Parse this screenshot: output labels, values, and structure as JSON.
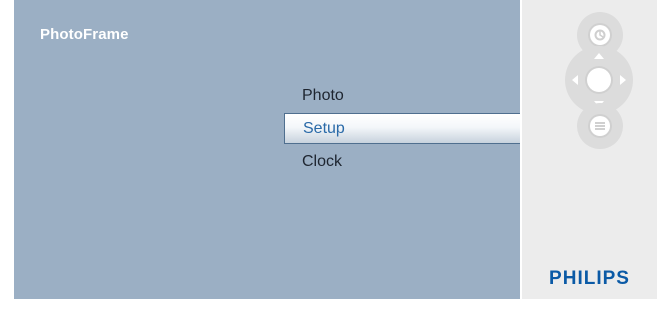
{
  "app": {
    "title": "PhotoFrame"
  },
  "menu": {
    "items": [
      {
        "label": "Photo",
        "selected": false
      },
      {
        "label": "Setup",
        "selected": true
      },
      {
        "label": "Clock",
        "selected": false
      }
    ]
  },
  "controls": {
    "buttons": [
      {
        "name": "home-button",
        "icon": "home-icon"
      },
      {
        "name": "navigation-pad",
        "icon": "dpad-icon"
      },
      {
        "name": "menu-button",
        "icon": "menu-icon"
      }
    ]
  },
  "brand": {
    "name": "PHILIPS",
    "color": "#0b5aa6"
  },
  "colors": {
    "panel": "#9bafc4",
    "selected_text": "#2a6aa8",
    "sidebar": "#ececec"
  }
}
